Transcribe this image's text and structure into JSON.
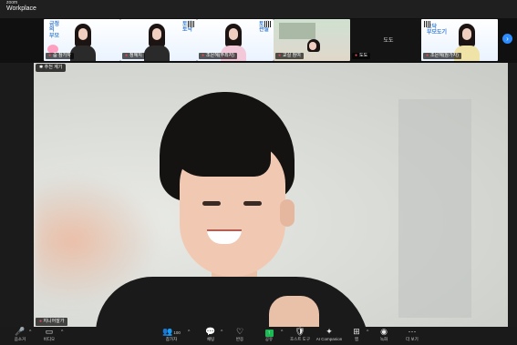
{
  "app": {
    "title_line1": "zoom",
    "title_line2": "Workplace"
  },
  "thumbnails": [
    {
      "name": "줌 참가자",
      "poster": "긍정\n의\n부모",
      "variant": "poster",
      "muted": true
    },
    {
      "name": "정혜지",
      "poster": "토닥\n토닥",
      "variant": "poster",
      "muted": true
    },
    {
      "name": "조은혜(주최자)",
      "poster": "",
      "variant": "poster",
      "muted": true
    },
    {
      "name": "교실 참여",
      "poster": "",
      "variant": "room",
      "muted": true
    },
    {
      "name": "도도",
      "poster": "",
      "variant": "empty",
      "muted": true,
      "center_label": "도도"
    },
    {
      "name": "조은혜(참가자)",
      "poster": "부모도기",
      "variant": "poster",
      "muted": true
    }
  ],
  "next_button": "›",
  "main_video": {
    "top_tag": "추천 계기",
    "speaker_name": "지니어잘가"
  },
  "toolbar": {
    "items": [
      {
        "id": "audio",
        "icon": "🎤",
        "icon_name": "mic-muted-icon",
        "label": "음소거",
        "caret": true,
        "red": true
      },
      {
        "id": "video",
        "icon": "▭",
        "icon_name": "video-icon",
        "label": "비디오",
        "caret": true
      },
      {
        "id": "participants",
        "icon": "👥",
        "icon_name": "participants-icon",
        "label": "참가자",
        "count": "100",
        "caret": true
      },
      {
        "id": "chat",
        "icon": "💬",
        "icon_name": "chat-icon",
        "label": "채팅",
        "caret": true
      },
      {
        "id": "react",
        "icon": "♡",
        "icon_name": "react-icon",
        "label": "반응"
      },
      {
        "id": "share",
        "icon": "↑",
        "icon_name": "share-screen-icon",
        "label": "공유",
        "caret": true,
        "green": true
      },
      {
        "id": "host-tools",
        "icon": "🛡",
        "icon_name": "host-tools-icon",
        "label": "호스트 도구"
      },
      {
        "id": "ai",
        "icon": "✦",
        "icon_name": "ai-companion-icon",
        "label": "AI Companion"
      },
      {
        "id": "apps",
        "icon": "⊞",
        "icon_name": "apps-icon",
        "label": "앱",
        "caret": true
      },
      {
        "id": "record",
        "icon": "◉",
        "icon_name": "record-icon",
        "label": "녹화"
      },
      {
        "id": "more",
        "icon": "⋯",
        "icon_name": "more-icon",
        "label": "더 보기"
      }
    ]
  }
}
